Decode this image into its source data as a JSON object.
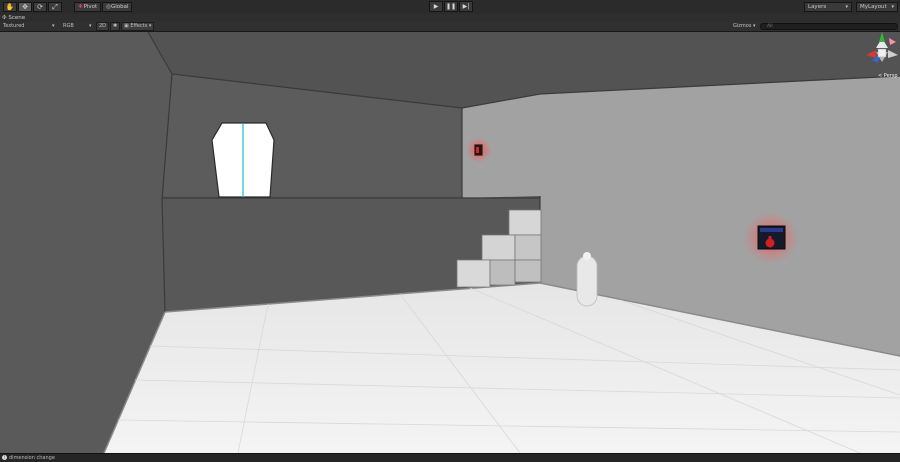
{
  "toolbar": {
    "tools": [
      {
        "name": "hand-tool",
        "glyph": "✋"
      },
      {
        "name": "move-tool",
        "glyph": "✥"
      },
      {
        "name": "rotate-tool",
        "glyph": "⟳"
      },
      {
        "name": "scale-tool",
        "glyph": "⤢"
      }
    ],
    "pivot_label": "Pivot",
    "global_label": "Global",
    "play_glyph": "▶",
    "pause_glyph": "❚❚",
    "step_glyph": "▶|",
    "layers_label": "Layers",
    "layout_label": "MyLayout"
  },
  "scene_tab": {
    "label": "Scene"
  },
  "scene_options": {
    "draw_mode": "Textured",
    "render_mode": "RGB",
    "mode_2d": "2D",
    "effects_label": "Effects",
    "gizmos_label": "Gizmos",
    "search_placeholder": "All"
  },
  "gizmo": {
    "projection_label": "< Persp"
  },
  "status": {
    "message": "dimension change"
  },
  "colors": {
    "accent_red": "#e04848",
    "glow_red": "#ff3c3c",
    "door_cyan": "#29c2d6"
  }
}
